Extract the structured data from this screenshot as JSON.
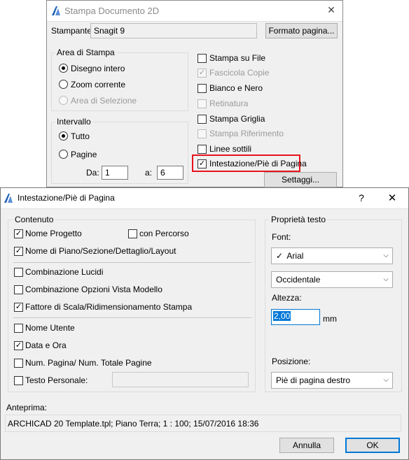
{
  "print_dialog": {
    "title": "Stampa Documento 2D",
    "close_glyph": "✕",
    "printer_label": "Stampante:",
    "printer_value": "Snagit 9",
    "page_format_button": "Formato pagina...",
    "print_area": {
      "legend": "Area di Stampa",
      "options": [
        "Disegno intero",
        "Zoom corrente",
        "Area di Selezione"
      ],
      "selected": "Disegno intero"
    },
    "interval": {
      "legend": "Intervallo",
      "options": [
        "Tutto",
        "Pagine"
      ],
      "selected": "Tutto",
      "from_label": "Da:",
      "from_value": "1",
      "to_label": "a:",
      "to_value": "6"
    },
    "options": [
      {
        "label": "Stampa su File",
        "checked": false,
        "enabled": true
      },
      {
        "label": "Fascicola Copie",
        "checked": true,
        "enabled": false
      },
      {
        "label": "Bianco e Nero",
        "checked": false,
        "enabled": true
      },
      {
        "label": "Retinatura",
        "checked": false,
        "enabled": false
      },
      {
        "label": "Stampa Griglia",
        "checked": false,
        "enabled": true
      },
      {
        "label": "Stampa Riferimento",
        "checked": false,
        "enabled": false
      },
      {
        "label": "Linee sottili",
        "checked": false,
        "enabled": true
      },
      {
        "label": "Intestazione/Piè di Pagina",
        "checked": true,
        "enabled": true
      }
    ],
    "settings_button": "Settaggi...",
    "highlight_color": "#e8131b"
  },
  "header_dialog": {
    "title": "Intestazione/Piè di Pagina",
    "help_glyph": "?",
    "close_glyph": "✕",
    "content_legend": "Contenuto",
    "items": {
      "project_name": {
        "label": "Nome Progetto",
        "checked": true
      },
      "with_path": {
        "label": "con Percorso",
        "checked": false
      },
      "floor_name": {
        "label": "Nome di Piano/Sezione/Dettaglio/Layout",
        "checked": true
      },
      "layer_combo": {
        "label": "Combinazione Lucidi",
        "checked": false
      },
      "view_options": {
        "label": "Combinazione Opzioni Vista Modello",
        "checked": false
      },
      "scale_factor": {
        "label": "Fattore di Scala/Ridimensionamento Stampa",
        "checked": true
      },
      "user_name": {
        "label": "Nome Utente",
        "checked": false
      },
      "date_time": {
        "label": "Data e Ora",
        "checked": true
      },
      "page_num": {
        "label": "Num. Pagina/ Num. Totale Pagine",
        "checked": false
      },
      "custom_text": {
        "label": "Testo Personale:",
        "checked": false,
        "value": ""
      }
    },
    "text_props": {
      "legend": "Proprietà testo",
      "font_label": "Font:",
      "font_value": "Arial",
      "font_check": "✓",
      "charset_value": "Occidentale",
      "height_label": "Altezza:",
      "height_value": "2,00",
      "height_unit": "mm",
      "position_label": "Posizione:",
      "position_value": "Piè di pagina destro"
    },
    "preview_label": "Anteprima:",
    "preview_text": "ARCHICAD 20 Template.tpl; Piano Terra; 1 : 100; 15/07/2016 18:36",
    "cancel_button": "Annulla",
    "ok_button": "OK",
    "accent": "#0078d7"
  }
}
